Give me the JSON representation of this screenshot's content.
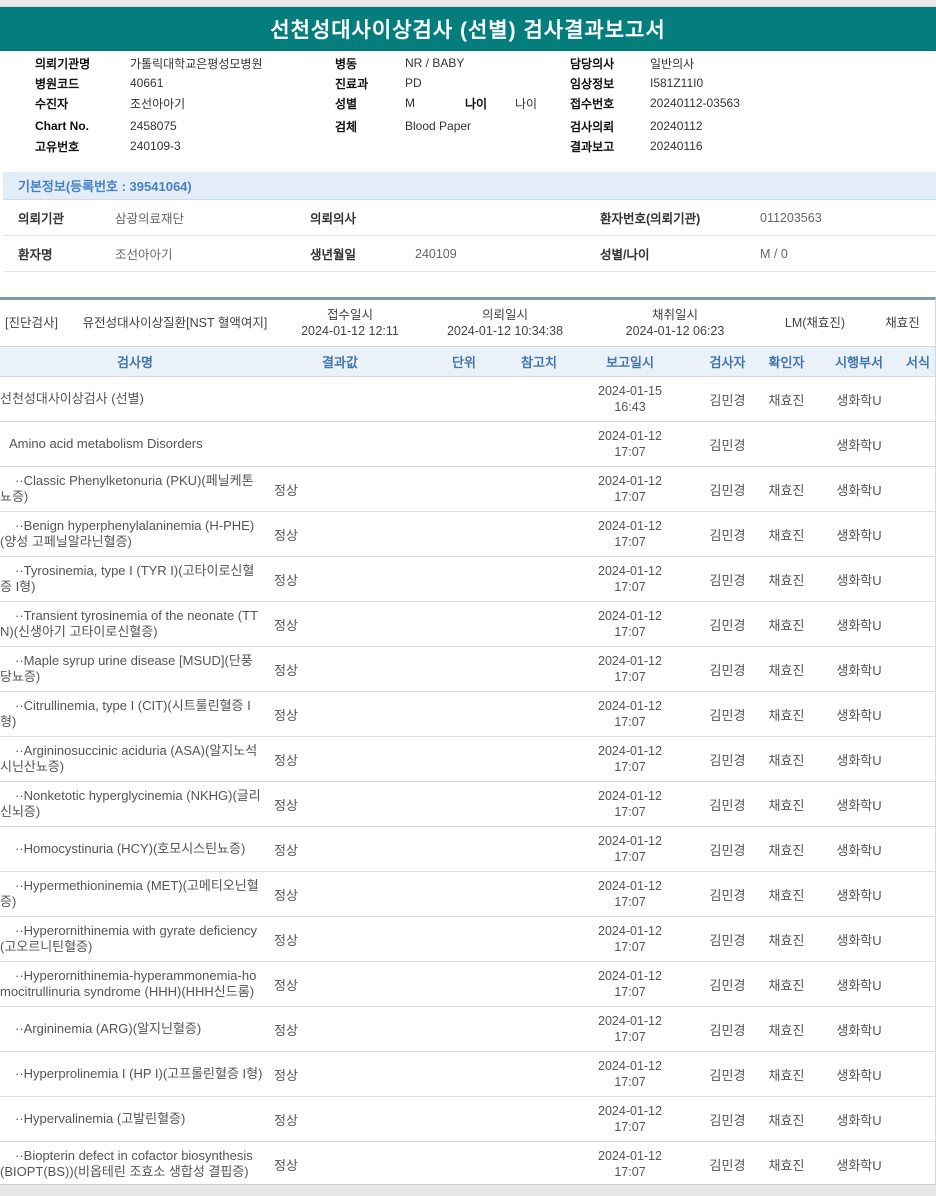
{
  "title": "선천성대사이상검사 (선별) 검사결과보고서",
  "colors": {
    "header_bar": "#047e7c",
    "section_header_text": "#4681c0",
    "section_header_bg": "#e2edf8",
    "table_header_text": "#4377ac",
    "table_header_bg": "#eaf1f9",
    "table_top_border": "#7e9cb5"
  },
  "header_info": {
    "col1": [
      {
        "label": "의뢰기관명",
        "value": "가톨릭대학교은평성모병원"
      },
      {
        "label": "병원코드",
        "value": "40661"
      },
      {
        "label": "수진자",
        "value": "조선아아기"
      },
      {
        "label": "Chart No.",
        "value": "2458075"
      },
      {
        "label": "고유번호",
        "value": "240109-3"
      }
    ],
    "col2": [
      {
        "label": "병동",
        "value": "NR / BABY"
      },
      {
        "label": "진료과",
        "value": "PD"
      },
      {
        "label": "성별",
        "value": "M",
        "label2": "나이",
        "value2": "나이"
      },
      {
        "label": "검체",
        "value": "Blood Paper"
      }
    ],
    "col3": [
      {
        "label": "담당의사",
        "value": "일반의사"
      },
      {
        "label": "임상정보",
        "value": "I581Z11I0"
      },
      {
        "label": "접수번호",
        "value": "20240112-03563"
      },
      {
        "label": "검사의뢰",
        "value": "20240112"
      },
      {
        "label": "결과보고",
        "value": "20240116"
      }
    ]
  },
  "basic_info": {
    "header": "기본정보(등록번호 : 39541064)",
    "rows": [
      [
        {
          "label": "의뢰기관",
          "value": "삼광의료재단"
        },
        {
          "label": "의뢰의사",
          "value": ""
        },
        {
          "label": "환자번호(의뢰기관)",
          "value": "011203563"
        }
      ],
      [
        {
          "label": "환자명",
          "value": "조선아아기"
        },
        {
          "label": "생년월일",
          "value": "240109"
        },
        {
          "label": "성별/나이",
          "value": "M / 0"
        }
      ]
    ]
  },
  "diagnostic": {
    "tag": "[진단검사]",
    "test_group": "유전성대사이상질환[NST 혈액여지]",
    "columns": [
      {
        "label": "접수일시",
        "value": "2024-01-12 12:11"
      },
      {
        "label": "의뢰일시",
        "value": "2024-01-12 10:34:38"
      },
      {
        "label": "채취일시",
        "value": "2024-01-12 06:23"
      }
    ],
    "lm": "LM(채효진)",
    "collector": "채효진"
  },
  "results_table": {
    "headers": [
      "검사명",
      "결과값",
      "단위",
      "참고치",
      "보고일시",
      "검사자",
      "확인자",
      "시행부서",
      "서식"
    ],
    "rows": [
      {
        "level": 0,
        "name": "선천성대사이상검사 (선별)",
        "result": "",
        "report_date": "2024-01-15",
        "report_time": "16:43",
        "tester": "김민경",
        "verifier": "채효진",
        "dept": "생화학U"
      },
      {
        "level": 1,
        "name": "Amino acid metabolism Disorders",
        "result": "",
        "report_date": "2024-01-12",
        "report_time": "17:07",
        "tester": "김민경",
        "verifier": "",
        "dept": "생화학U"
      },
      {
        "level": 2,
        "name": "··Classic Phenylketonuria (PKU)(페닐케톤뇨증)",
        "result": "정상",
        "report_date": "2024-01-12",
        "report_time": "17:07",
        "tester": "김민경",
        "verifier": "채효진",
        "dept": "생화학U"
      },
      {
        "level": 2,
        "name": "··Benign hyperphenylalaninemia (H-PHE)(양성 고페닐알라닌혈증)",
        "result": "정상",
        "report_date": "2024-01-12",
        "report_time": "17:07",
        "tester": "김민경",
        "verifier": "채효진",
        "dept": "생화학U"
      },
      {
        "level": 2,
        "name": "··Tyrosinemia, type I (TYR I)(고타이로신혈증 I형)",
        "result": "정상",
        "report_date": "2024-01-12",
        "report_time": "17:07",
        "tester": "김민경",
        "verifier": "채효진",
        "dept": "생화학U"
      },
      {
        "level": 2,
        "name": "··Transient tyrosinemia of the neonate (TTN)(신생아기 고타이로신혈증)",
        "result": "정상",
        "report_date": "2024-01-12",
        "report_time": "17:07",
        "tester": "김민경",
        "verifier": "채효진",
        "dept": "생화학U"
      },
      {
        "level": 2,
        "name": "··Maple syrup urine disease [MSUD](단풍당뇨증)",
        "result": "정상",
        "report_date": "2024-01-12",
        "report_time": "17:07",
        "tester": "김민경",
        "verifier": "채효진",
        "dept": "생화학U"
      },
      {
        "level": 2,
        "name": "··Citrullinemia, type I (CIT)(시트룰린혈증 I형)",
        "result": "정상",
        "report_date": "2024-01-12",
        "report_time": "17:07",
        "tester": "김민경",
        "verifier": "채효진",
        "dept": "생화학U"
      },
      {
        "level": 2,
        "name": "··Argininosuccinic aciduria (ASA)(알지노석시닌산뇨증)",
        "result": "정상",
        "report_date": "2024-01-12",
        "report_time": "17:07",
        "tester": "김민경",
        "verifier": "채효진",
        "dept": "생화학U"
      },
      {
        "level": 2,
        "name": "··Nonketotic hyperglycinemia (NKHG)(글리신뇌증)",
        "result": "정상",
        "report_date": "2024-01-12",
        "report_time": "17:07",
        "tester": "김민경",
        "verifier": "채효진",
        "dept": "생화학U"
      },
      {
        "level": 2,
        "name": "··Homocystinuria (HCY)(호모시스틴뇨증)",
        "result": "정상",
        "report_date": "2024-01-12",
        "report_time": "17:07",
        "tester": "김민경",
        "verifier": "채효진",
        "dept": "생화학U"
      },
      {
        "level": 2,
        "name": "··Hypermethioninemia (MET)(고메티오닌혈증)",
        "result": "정상",
        "report_date": "2024-01-12",
        "report_time": "17:07",
        "tester": "김민경",
        "verifier": "채효진",
        "dept": "생화학U"
      },
      {
        "level": 2,
        "name": "··Hyperornithinemia with gyrate deficiency(고오르니틴혈증)",
        "result": "정상",
        "report_date": "2024-01-12",
        "report_time": "17:07",
        "tester": "김민경",
        "verifier": "채효진",
        "dept": "생화학U"
      },
      {
        "level": 2,
        "name": "··Hyperornithinemia-hyperammonemia-homocitrullinuria syndrome (HHH)(HHH신드롬)",
        "result": "정상",
        "report_date": "2024-01-12",
        "report_time": "17:07",
        "tester": "김민경",
        "verifier": "채효진",
        "dept": "생화학U"
      },
      {
        "level": 2,
        "name": "··Argininemia (ARG)(알지닌혈증)",
        "result": "정상",
        "report_date": "2024-01-12",
        "report_time": "17:07",
        "tester": "김민경",
        "verifier": "채효진",
        "dept": "생화학U"
      },
      {
        "level": 2,
        "name": "··Hyperprolinemia I (HP I)(고프롤린혈증 I형)",
        "result": "정상",
        "report_date": "2024-01-12",
        "report_time": "17:07",
        "tester": "김민경",
        "verifier": "채효진",
        "dept": "생화학U"
      },
      {
        "level": 2,
        "name": "··Hypervalinemia (고발린혈증)",
        "result": "정상",
        "report_date": "2024-01-12",
        "report_time": "17:07",
        "tester": "김민경",
        "verifier": "채효진",
        "dept": "생화학U"
      },
      {
        "level": 2,
        "name": "··Biopterin defect in cofactor biosynthesis (BIOPT(BS))(비옵테린 조효소 생합성 결핍증)",
        "result": "정상",
        "report_date": "2024-01-12",
        "report_time": "17:07",
        "tester": "김민경",
        "verifier": "채효진",
        "dept": "생화학U"
      }
    ]
  }
}
